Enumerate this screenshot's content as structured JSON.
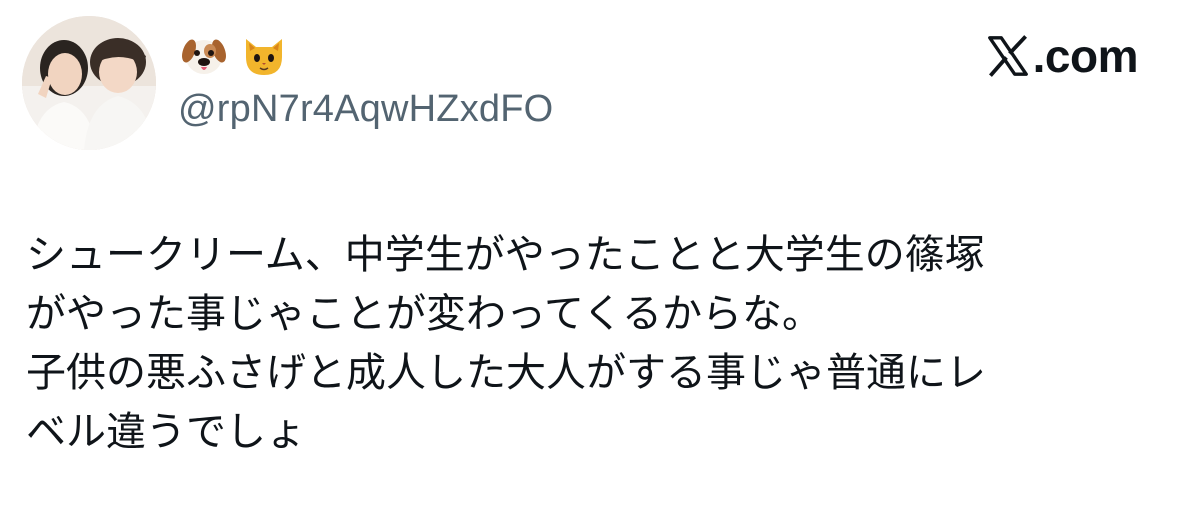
{
  "header": {
    "display_name_icons": [
      "dog-face-emoji",
      "cat-face-emoji"
    ],
    "handle": "@rpN7r4AqwHZxdFO",
    "brand_label": "com",
    "brand_logo": "x-logo"
  },
  "tweet": {
    "lines": [
      "シュークリーム、中学生がやったことと大学生の篠塚",
      "がやった事じゃことが変わってくるからな。",
      "子供の悪ふさげと成人した大人がする事じゃ普通にレ",
      "ベル違うでしょ"
    ]
  },
  "colors": {
    "text": "#0f1419",
    "handle": "#536471",
    "background": "#ffffff"
  }
}
